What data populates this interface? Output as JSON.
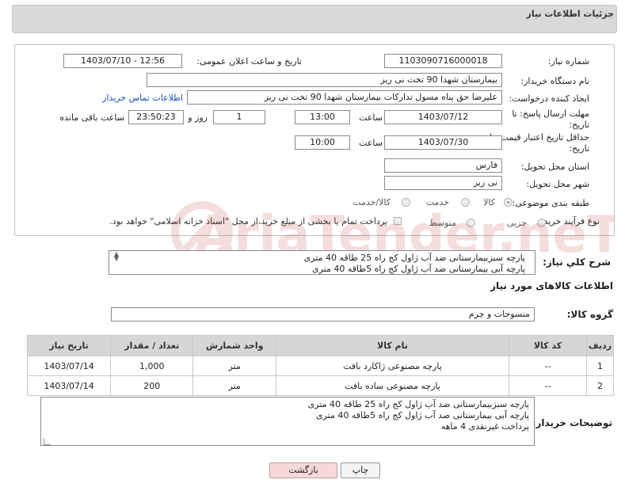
{
  "header": {
    "title": "جزئیات اطلاعات نیاز"
  },
  "form": {
    "need_number_label": "شماره نیاز:",
    "need_number": "1103090716000018",
    "announce_label": "تاریخ و ساعت اعلان عمومی:",
    "announce_value": "1403/07/10 - 12:56",
    "buyer_org_label": "نام دستگاه خریدار:",
    "buyer_org": "بیمارستان شهدا 90 تخت نی ریز",
    "requester_label": "ایجاد کننده درخواست:",
    "requester": "علیرضا حق پناه مسول تدارکات بیمارستان شهدا 90 تخت نی ریز",
    "contact_link": "اطلاعات تماس خریدار",
    "deadline_label_1": "مهلت ارسال پاسخ: تا",
    "deadline_label_2": "تاریخ:",
    "deadline_date": "1403/07/12",
    "time_label": "ساعت",
    "deadline_time": "13:00",
    "days_value": "1",
    "days_label": "روز و",
    "remaining_value": "23:50:23",
    "remaining_label": "ساعت باقی مانده",
    "validity_label_1": "حداقل تاریخ اعتبار قیمت: تا",
    "validity_label_2": "تاریخ:",
    "validity_date": "1403/07/30",
    "validity_time": "10:00",
    "province_label": "استان محل تحویل:",
    "province": "فارس",
    "city_label": "شهر محل تحویل:",
    "city": "نی ریز",
    "category_label": "طبقه بندی موضوعی:",
    "category_options": [
      "کالا",
      "خدمت",
      "کالا/خدمت"
    ],
    "process_label": "نوع فرآیند خرید :",
    "process_options": [
      "جزیی",
      "متوسط"
    ],
    "payment_note": "پرداخت تمام یا بخشی از مبلغ خرید،از محل \"اسناد خزانه اسلامی\" خواهد بود."
  },
  "summary": {
    "label": "شرح کلي نياز:",
    "lines": [
      "پارچه سبزبیمارستانی  ضد آب ژاول کج راه 25 طاقه 40 متری",
      "پارچه آبی بیمارستانی ضد آب ژاول کج راه  5طاقه 40 متری"
    ]
  },
  "goods_section_title": "اطلاعات کالاهای مورد نیاز",
  "goods_group": {
    "label": "گروه کالا:",
    "value": "منسوجات و چرم"
  },
  "table": {
    "headers": [
      "ردیف",
      "کد کالا",
      "نام کالا",
      "واحد شمارش",
      "تعداد / مقدار",
      "تاریخ نیاز"
    ],
    "rows": [
      [
        "1",
        "--",
        "پارچه مصنوعی ژاکارد بافت",
        "متر",
        "1,000",
        "1403/07/14"
      ],
      [
        "2",
        "--",
        "پارچه مصنوعی ساده بافت",
        "متر",
        "200",
        "1403/07/14"
      ]
    ]
  },
  "buyer_notes": {
    "label": "توضیحات خریدار:",
    "lines": [
      "پارچه سبزبیمارستانی  ضد آب ژاول کج راه 25 طاقه 40 متری",
      "پارچه آبی بیمارستانی ضد آب ژاول کج راه  5طاقه 40 متری",
      "پرداخت غیرنقدی 4 ماهه"
    ]
  },
  "buttons": {
    "print": "چاپ",
    "back": "بازگشت"
  },
  "watermark_text": "AriaTender.neT",
  "colors": {
    "link": "#1a4fb3",
    "back_button_bg": "#f7d9d9",
    "print_button_bg": "#f4f4f4",
    "header_bg": "#d9d9d9"
  }
}
